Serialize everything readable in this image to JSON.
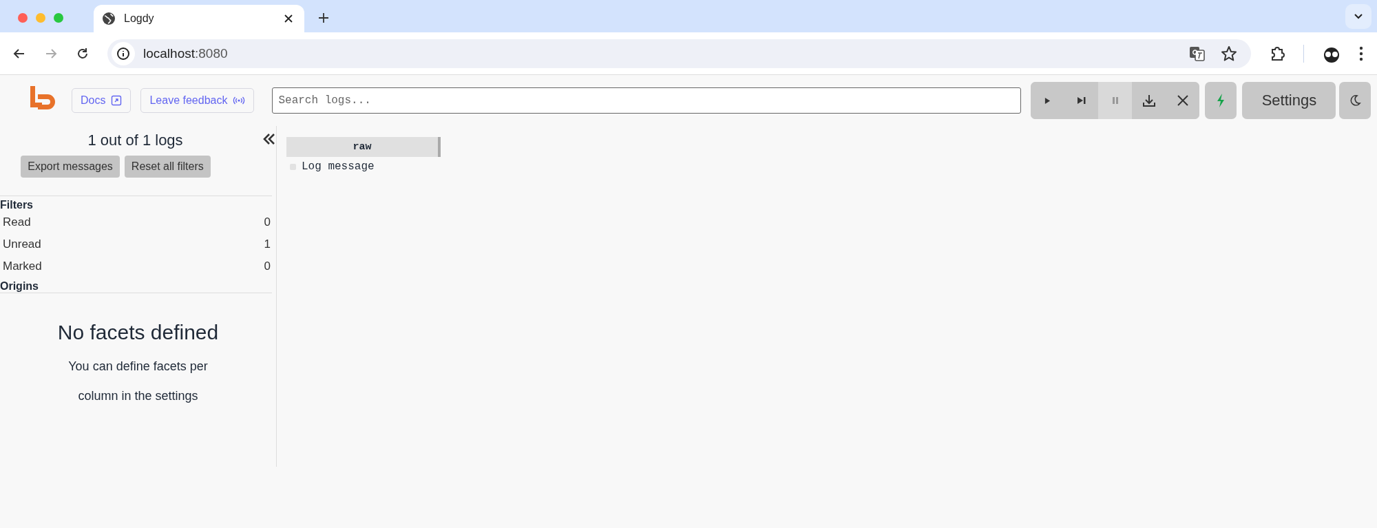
{
  "browser": {
    "tab": {
      "title": "Logdy"
    },
    "url": {
      "host": "localhost",
      "port": ":8080"
    }
  },
  "header": {
    "links": [
      {
        "label": "Docs",
        "kind": "external"
      },
      {
        "label": "Leave feedback",
        "kind": "feedback"
      }
    ],
    "search": {
      "placeholder": "Search logs..."
    },
    "controls": [
      {
        "kind": "play",
        "active": false
      },
      {
        "kind": "step",
        "active": false
      },
      {
        "kind": "pause",
        "active": true
      },
      {
        "kind": "download",
        "active": false
      },
      {
        "kind": "clear",
        "active": false
      }
    ],
    "settings": "Settings"
  },
  "sidebar": {
    "count": "1 out of 1 logs",
    "buttons": [
      "Export messages",
      "Reset all filters"
    ],
    "filters_title": "Filters",
    "filters": [
      {
        "label": "Read",
        "count": "0"
      },
      {
        "label": "Unread",
        "count": "1"
      },
      {
        "label": "Marked",
        "count": "0"
      }
    ],
    "origins_title": "Origins",
    "empty": {
      "title": "No facets defined",
      "lines": [
        "You can define facets per",
        "column in the settings"
      ]
    }
  },
  "table": {
    "columns": [
      "raw"
    ],
    "rows": [
      {
        "raw": "Log message"
      }
    ]
  }
}
